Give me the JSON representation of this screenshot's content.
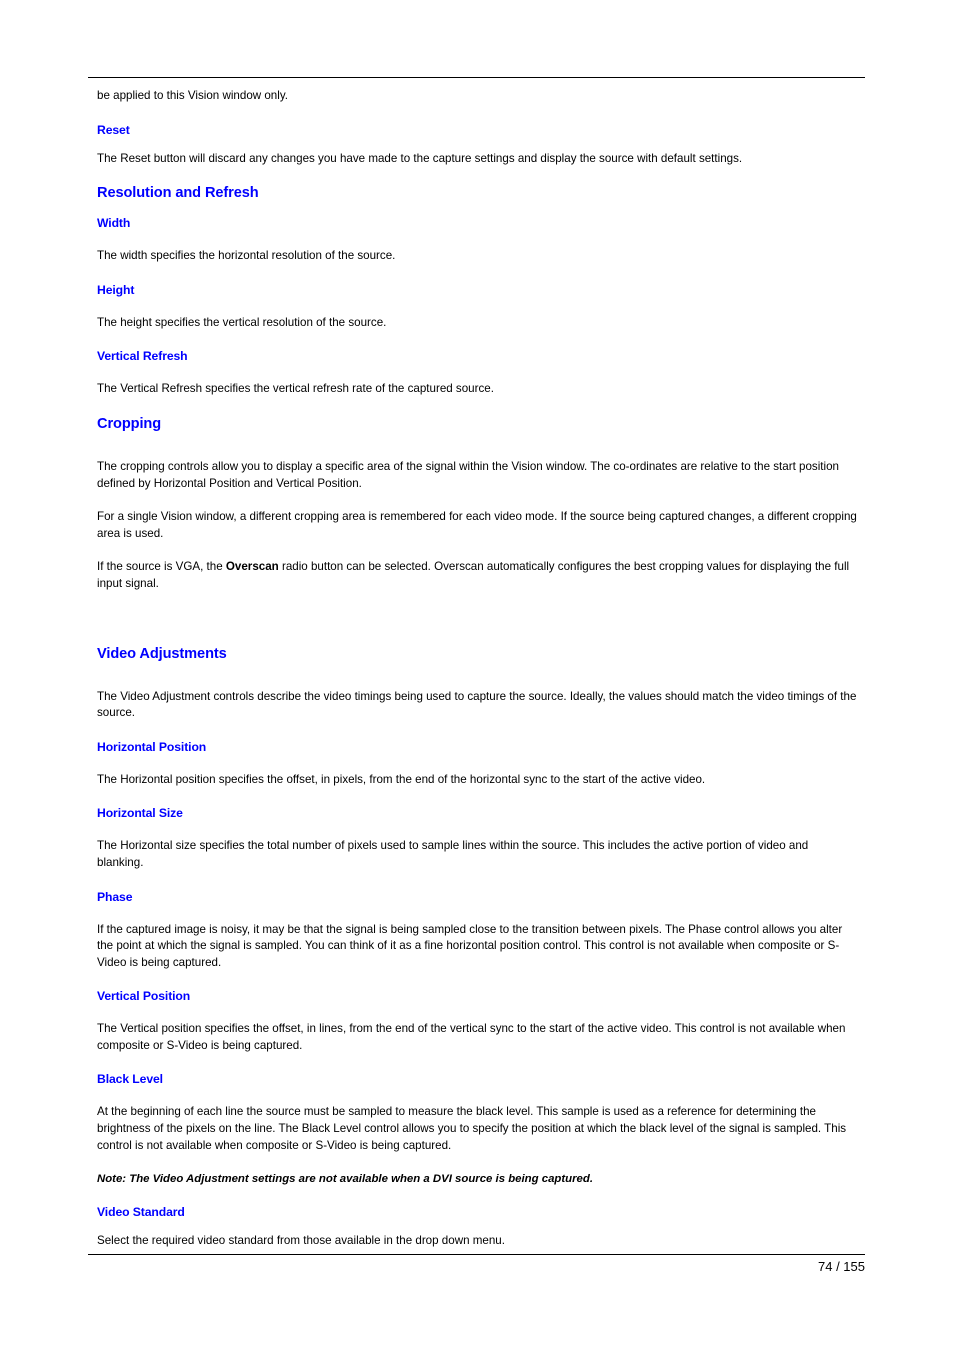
{
  "document": {
    "continued_paragraph": "be applied to this Vision window only.",
    "sections": [
      {
        "id": "reset",
        "heading": "Reset",
        "heading_level": 3,
        "paragraphs": [
          "The Reset button will discard any changes you have made to the capture settings and display the source with default settings."
        ]
      },
      {
        "id": "resolution-and-refresh",
        "heading": "Resolution and Refresh",
        "heading_level": 2,
        "paragraphs": []
      },
      {
        "id": "width",
        "heading": "Width",
        "heading_level": 3,
        "paragraphs": [
          "The width specifies the horizontal resolution of the source."
        ]
      },
      {
        "id": "height",
        "heading": "Height",
        "heading_level": 3,
        "paragraphs": [
          "The height specifies the vertical resolution of the source."
        ]
      },
      {
        "id": "vertical-refresh",
        "heading": "Vertical Refresh",
        "heading_level": 3,
        "paragraphs": [
          "The Vertical Refresh specifies the vertical refresh rate of the captured source."
        ]
      },
      {
        "id": "cropping",
        "heading": "Cropping",
        "heading_level": 2,
        "paragraphs": [
          "The cropping controls allow you to display a specific area of the signal within the Vision window. The co-ordinates are relative to the start position defined by Horizontal Position and Vertical Position.",
          "For a single Vision window, a different cropping area is remembered for each video mode. If the source being captured changes, a different cropping area is used."
        ]
      },
      {
        "id": "video-adjustments",
        "heading": "Video Adjustments",
        "heading_level": 2,
        "paragraphs": [
          "The Video Adjustment controls describe the video timings being used to capture the source. Ideally, the values should match the video timings of the source."
        ]
      },
      {
        "id": "horizontal-position",
        "heading": "Horizontal Position",
        "heading_level": 3,
        "paragraphs": [
          "The Horizontal position specifies the offset, in pixels, from the end of the horizontal sync to the start of the active video."
        ]
      },
      {
        "id": "horizontal-size",
        "heading": "Horizontal Size",
        "heading_level": 3,
        "paragraphs": [
          "The Horizontal size specifies the total number of pixels used to sample lines within the source. This includes the active portion of video and blanking."
        ]
      },
      {
        "id": "phase",
        "heading": "Phase",
        "heading_level": 3,
        "paragraphs": [
          "If the captured image is noisy, it may be that the signal is being sampled close to the transition between pixels. The Phase control allows you alter the point at which the signal is sampled. You can think of it as a fine horizontal position control. This control is not available when composite or S-Video is being captured."
        ]
      },
      {
        "id": "vertical-position",
        "heading": "Vertical Position",
        "heading_level": 3,
        "paragraphs": [
          "The Vertical position specifies the offset, in lines, from the end of the vertical sync to the start of the active video. This control is not available when composite or S-Video is being captured."
        ]
      },
      {
        "id": "black-level",
        "heading": "Black Level",
        "heading_level": 3,
        "paragraphs": [
          "At the beginning of each line the source must be sampled to measure the black level. This sample is used as a reference for determining the brightness of the pixels on the line. The Black Level control allows you to specify the position at which the black level of the signal is sampled. This control is not available when composite or S-Video is being captured."
        ]
      },
      {
        "id": "video-standard",
        "heading": "Video Standard",
        "heading_level": 3,
        "paragraphs": [
          "Select the required video standard from those available in the drop down menu."
        ]
      }
    ],
    "overscan_paragraph": {
      "before": "If the source is VGA, the ",
      "bold": "Overscan",
      "after": " radio button can be selected. Overscan automatically configures the best cropping values for displaying the full input signal."
    },
    "note": "Note: The Video Adjustment settings are not available when a DVI source is being captured."
  },
  "footer": {
    "page_indicator": "74 / 155"
  },
  "colors": {
    "heading": "#0000ff",
    "body": "#000000",
    "background": "#ffffff",
    "rule": "#000000"
  }
}
